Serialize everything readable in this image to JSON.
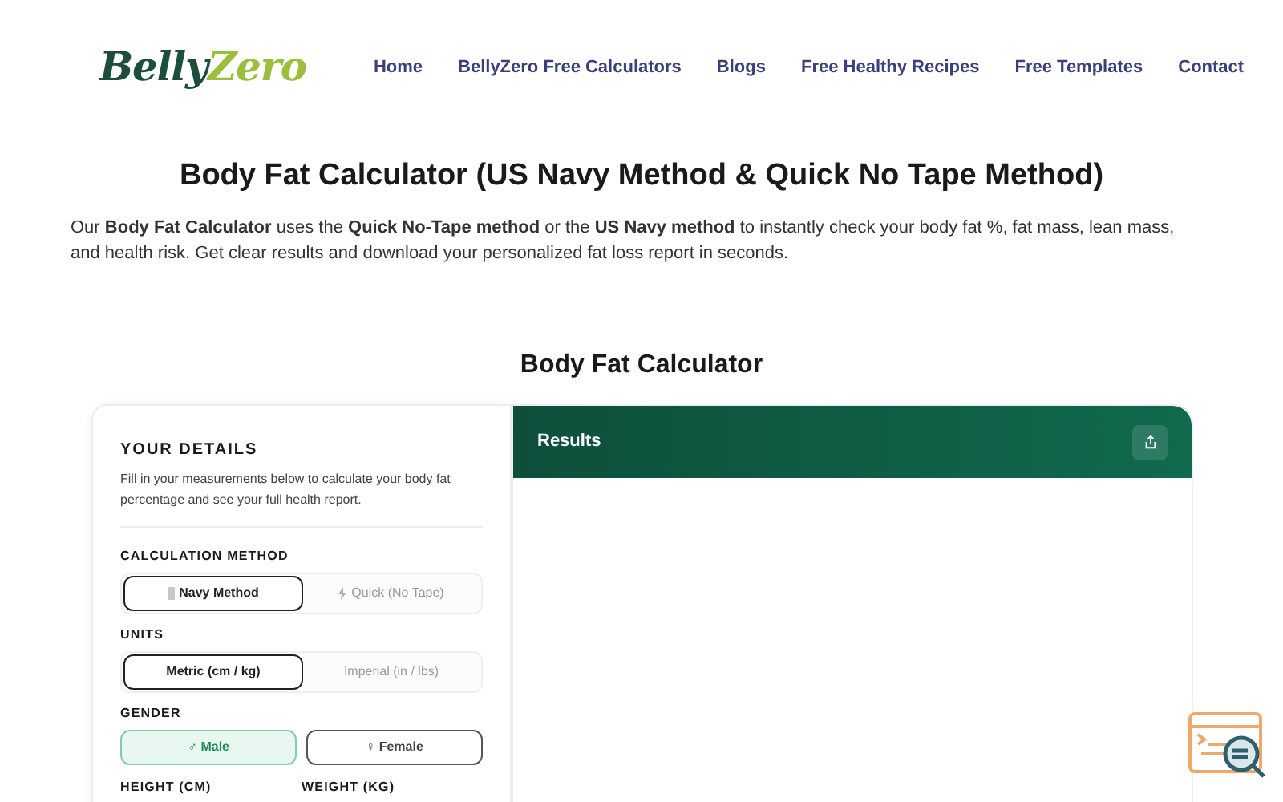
{
  "logo": {
    "part1": "Belly",
    "part2": "Zero"
  },
  "nav": [
    "Home",
    "BellyZero Free Calculators",
    "Blogs",
    "Free Healthy Recipes",
    "Free Templates",
    "Contact"
  ],
  "title": "Body Fat Calculator (US Navy Method & Quick No Tape Method)",
  "intro": "Our **Body Fat Calculator** uses the **Quick No-Tape method** or the **US Navy method** to instantly check your body fat %, fat mass, lean mass, and health risk. Get clear results and download your personalized fat loss report in seconds.",
  "section_title": "Body Fat Calculator",
  "details": {
    "heading": "YOUR DETAILS",
    "description": "Fill in your measurements below to calculate your body fat percentage and see your full health report.",
    "groups": [
      {
        "label": "CALCULATION METHOD",
        "kind": "segmented",
        "options": [
          {
            "label": "Navy Method",
            "selected": true
          },
          {
            "label": "Quick (No Tape)",
            "selected": false
          }
        ]
      },
      {
        "label": "UNITS",
        "kind": "segmented",
        "options": [
          {
            "label": "Metric (cm / kg)",
            "selected": true
          },
          {
            "label": "Imperial (in / lbs)",
            "selected": false
          }
        ]
      },
      {
        "label": "GENDER",
        "kind": "pills",
        "options": [
          {
            "label": "♂ Male",
            "selected": true
          },
          {
            "label": "♀ Female",
            "selected": false
          }
        ]
      }
    ],
    "fields": [
      "HEIGHT (CM)",
      "WEIGHT (KG)"
    ]
  },
  "results": {
    "title": "Results"
  }
}
